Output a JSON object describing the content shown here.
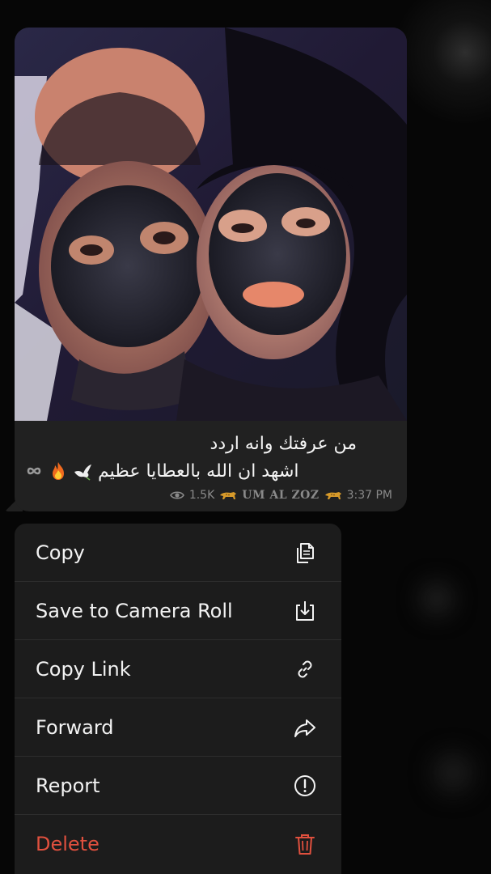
{
  "message": {
    "caption_line1": "من عرفتك وانه اردد",
    "caption_line2": "اشهد ان الله بالعطايا عظيم",
    "caption_emojis": [
      "dove-emoji",
      "fire-emoji",
      "infinity-icon"
    ],
    "views": "1.5K",
    "channel_name": "UM AL ZOZ",
    "time": "3:37 PM"
  },
  "context_menu": {
    "items": [
      {
        "label": "Copy",
        "icon": "copy-icon"
      },
      {
        "label": "Save to Camera Roll",
        "icon": "save-download-icon"
      },
      {
        "label": "Copy Link",
        "icon": "link-icon"
      },
      {
        "label": "Forward",
        "icon": "forward-arrow-icon"
      },
      {
        "label": "Report",
        "icon": "exclamation-circle-icon"
      },
      {
        "label": "Delete",
        "icon": "trash-icon"
      }
    ]
  },
  "colors": {
    "background": "#050505",
    "bubble": "#212121",
    "menu": "#1c1c1c",
    "text": "#f2f2f2",
    "meta": "#8a8a8a",
    "danger": "#e0503e"
  }
}
